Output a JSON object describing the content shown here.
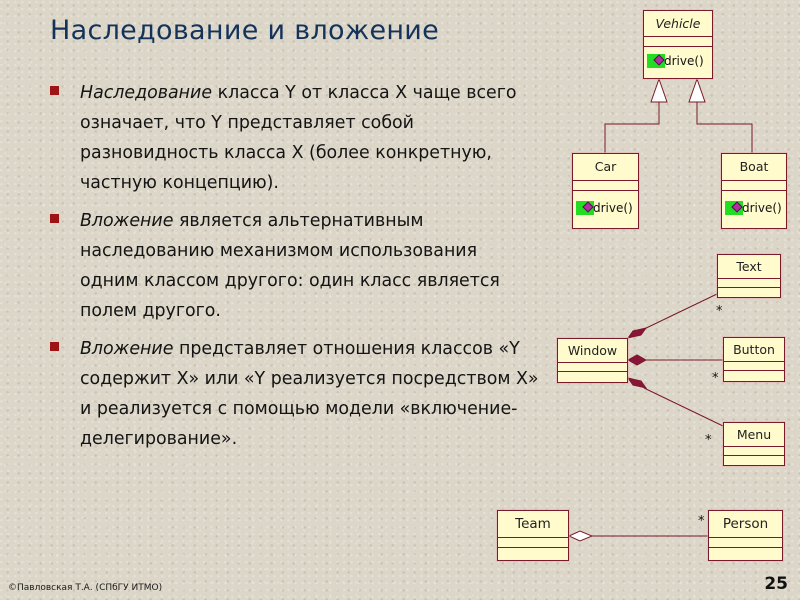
{
  "title": "Наследование и вложение",
  "bullets": [
    {
      "em": "Наследование",
      "text": " класса Y от класса X чаще всего означает, что Y представляет собой разновидность класса X (более конкретную, частную концепцию)."
    },
    {
      "em": "Вложение",
      "text": " является альтернативным наследованию механизмом использования одним классом другого: один класс является полем другого."
    },
    {
      "em": "Вложение",
      "text": " представляет отношения классов «Y содержит X» или «Y реализуется посредством X» и реализуется с помощью модели «включение-делегирование»."
    }
  ],
  "diagram": {
    "classes": {
      "vehicle": {
        "name": "Vehicle",
        "method": "drive()"
      },
      "car": {
        "name": "Car",
        "method": "drive()"
      },
      "boat": {
        "name": "Boat",
        "method": "drive()"
      },
      "text": {
        "name": "Text"
      },
      "window": {
        "name": "Window"
      },
      "button": {
        "name": "Button"
      },
      "menu": {
        "name": "Menu"
      },
      "team": {
        "name": "Team"
      },
      "person": {
        "name": "Person"
      }
    },
    "multiplicity": "*",
    "colors": {
      "line": "#7a1a2a",
      "diamond": "#8b1538",
      "box_fill": "#fffbcd",
      "method_icon": "#22dd22"
    }
  },
  "footer": "©Павловская Т.А. (СПбГУ ИТМО)",
  "page_number": "25"
}
